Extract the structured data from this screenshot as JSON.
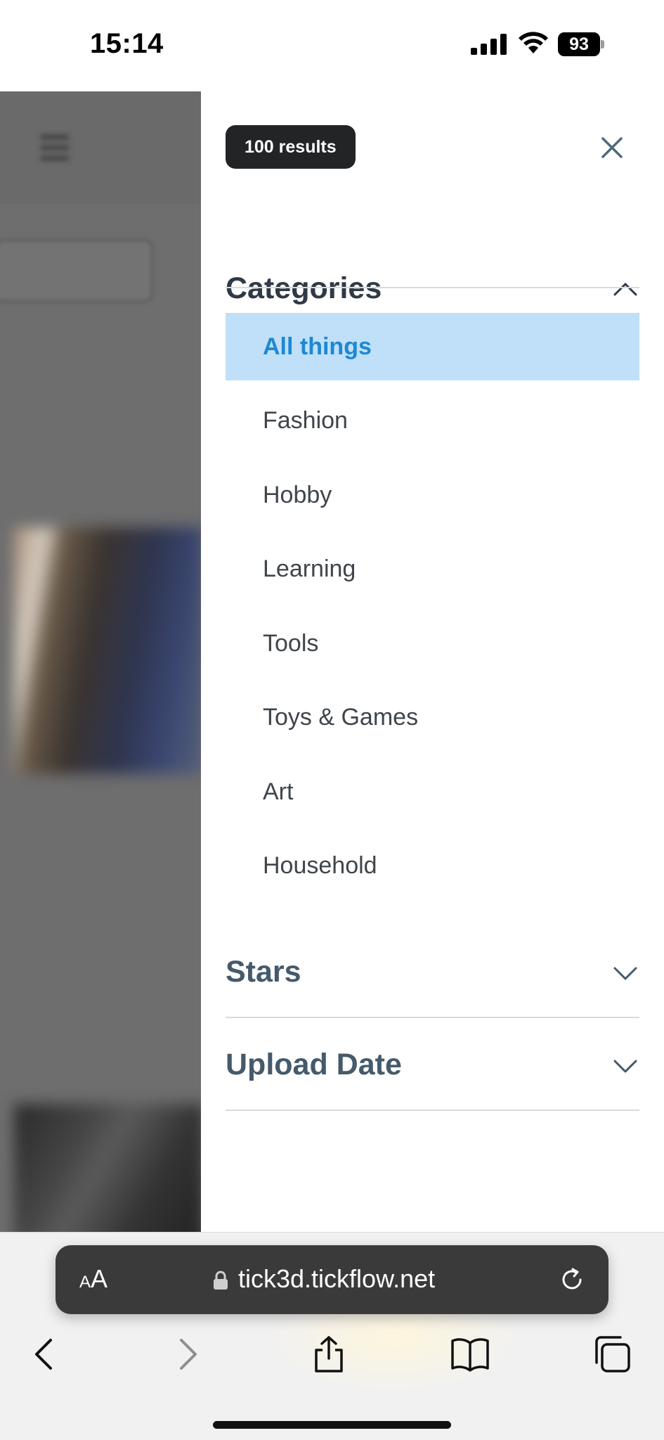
{
  "status_bar": {
    "time": "15:14",
    "battery": "93"
  },
  "drawer": {
    "results_badge": "100 results",
    "categories": {
      "title": "Categories",
      "expanded": true,
      "items": [
        {
          "label": "All things",
          "selected": true
        },
        {
          "label": "Fashion",
          "selected": false
        },
        {
          "label": "Hobby",
          "selected": false
        },
        {
          "label": "Learning",
          "selected": false
        },
        {
          "label": "Tools",
          "selected": false
        },
        {
          "label": "Toys & Games",
          "selected": false
        },
        {
          "label": "Art",
          "selected": false
        },
        {
          "label": "Household",
          "selected": false
        }
      ]
    },
    "stars": {
      "title": "Stars",
      "expanded": false
    },
    "upload_date": {
      "title": "Upload Date",
      "expanded": false
    }
  },
  "browser": {
    "text_size_small": "A",
    "text_size_large": "A",
    "url": "tick3d.tickflow.net"
  },
  "colors": {
    "badge_bg": "#222426",
    "selected_bg": "#bfe0f8",
    "selected_text": "#1e88d2",
    "heading_primary": "#2f3a45",
    "heading_collapsed": "#455a6b"
  }
}
